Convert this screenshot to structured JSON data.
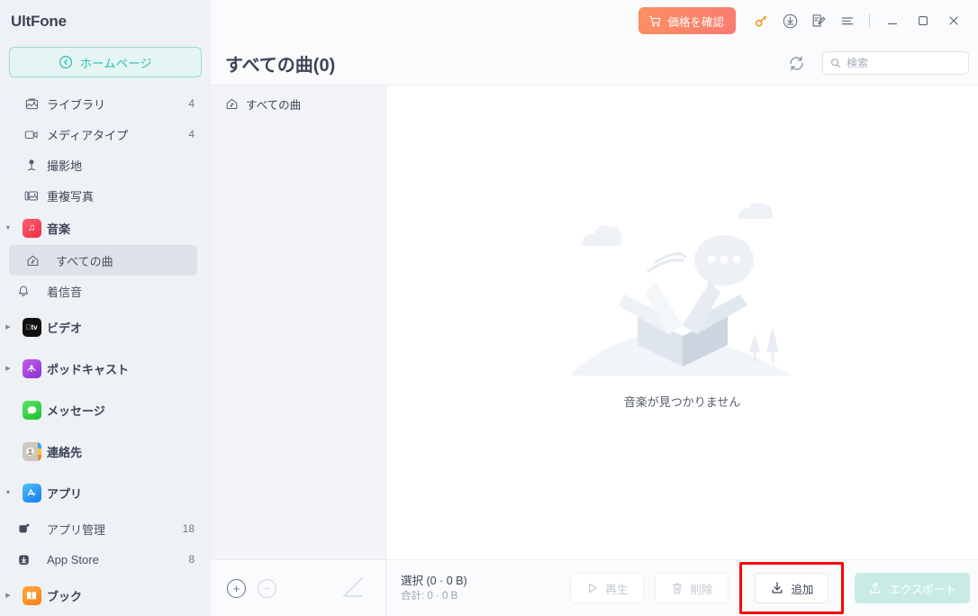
{
  "app": {
    "brand": "UltFone"
  },
  "sidebar": {
    "home_button": {
      "label": "ホームページ",
      "icon": "back-circle-icon",
      "color": "#27bdb6"
    },
    "items": [
      {
        "label": "ライブラリ",
        "count": "4",
        "icon": "photo-library-icon",
        "depth": 1,
        "caret": "none"
      },
      {
        "label": "メディアタイプ",
        "count": "4",
        "icon": "video-camera-icon",
        "depth": 1,
        "caret": "none"
      },
      {
        "label": "撮影地",
        "count": "",
        "icon": "location-pin-icon",
        "depth": 1,
        "caret": "none"
      },
      {
        "label": "重複写真",
        "count": "",
        "icon": "duplicate-photos-icon",
        "depth": 1,
        "caret": "none"
      },
      {
        "label": "音楽",
        "count": "",
        "icon": "music-app-icon",
        "depth": 0,
        "caret": "down"
      },
      {
        "label": "すべての曲",
        "count": "",
        "icon": "house-note-icon",
        "depth": 2,
        "caret": "none",
        "selected": true
      },
      {
        "label": "着信音",
        "count": "",
        "icon": "bell-icon",
        "depth": 2,
        "caret": "none"
      },
      {
        "label": "ビデオ",
        "count": "",
        "icon": "appletv-app-icon",
        "depth": 0,
        "caret": "right"
      },
      {
        "label": "ポッドキャスト",
        "count": "",
        "icon": "podcast-app-icon",
        "depth": 0,
        "caret": "right"
      },
      {
        "label": "メッセージ",
        "count": "",
        "icon": "messages-app-icon",
        "depth": 0,
        "caret": "none"
      },
      {
        "label": "連絡先",
        "count": "",
        "icon": "contacts-app-icon",
        "depth": 0,
        "caret": "none"
      },
      {
        "label": "アプリ",
        "count": "",
        "icon": "appstore-app-icon",
        "depth": 0,
        "caret": "down"
      },
      {
        "label": "アプリ管理",
        "count": "18",
        "icon": "app-manage-icon",
        "depth": 2,
        "caret": "none"
      },
      {
        "label": "App Store",
        "count": "8",
        "icon": "app-download-icon",
        "depth": 2,
        "caret": "none"
      },
      {
        "label": "ブック",
        "count": "",
        "icon": "books-app-icon",
        "depth": 0,
        "caret": "right"
      }
    ]
  },
  "titlebar": {
    "price_button": {
      "label": "価格を確認",
      "icon": "shopping-cart-icon",
      "color": "#fb8f61"
    },
    "key_icon": "key-icon",
    "download_icon": "download-circle-icon",
    "edit_icon": "note-edit-icon",
    "menu_icon": "hamburger-menu-icon",
    "minimize": "minimize-icon",
    "maximize": "maximize-icon",
    "close": "close-icon"
  },
  "header": {
    "title": "すべての曲(0)",
    "refresh_icon": "refresh-icon",
    "search": {
      "placeholder": "検索",
      "value": "",
      "icon": "search-icon"
    }
  },
  "subnav": {
    "items": [
      {
        "label": "すべての曲",
        "icon": "house-note-icon"
      }
    ]
  },
  "content": {
    "empty_text": "音楽が見つかりません",
    "illustration": "empty-box-illustration"
  },
  "footer": {
    "add_row_icon": "plus-circle-icon",
    "remove_row_icon": "minus-circle-icon",
    "pencil_icon": "pencil-icon",
    "selection_label": "選択 (0 · 0 B)",
    "total_label": "合計: 0 · 0 B",
    "buttons": [
      {
        "label": "再生",
        "icon": "play-icon",
        "state": "disabled"
      },
      {
        "label": "削除",
        "icon": "trash-icon",
        "state": "disabled"
      },
      {
        "label": "追加",
        "icon": "import-download-icon",
        "state": "highlighted"
      },
      {
        "label": "エクスポート",
        "icon": "export-upload-icon",
        "state": "export"
      }
    ],
    "highlight_color": "#fb0606"
  }
}
